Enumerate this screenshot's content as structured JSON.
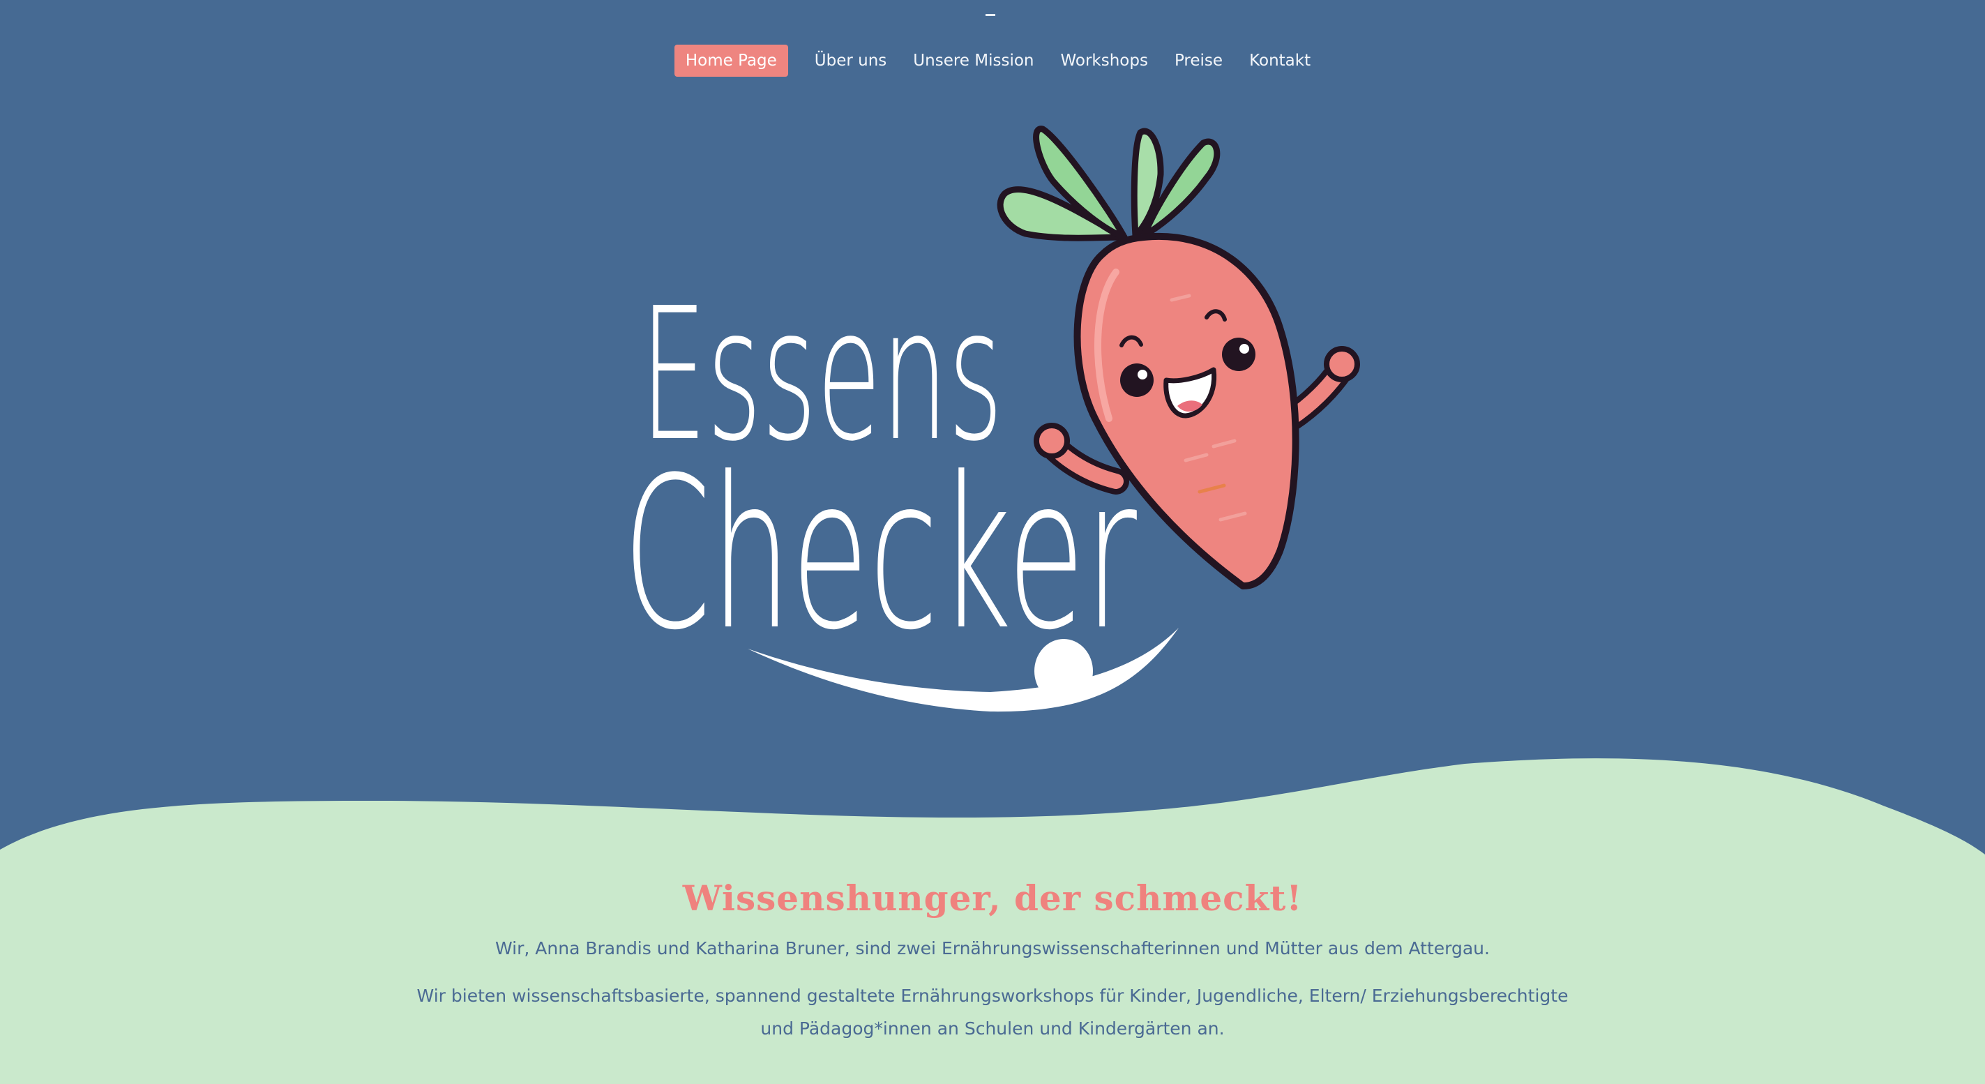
{
  "nav": {
    "items": [
      {
        "label": "Home Page",
        "active": true
      },
      {
        "label": "Über uns",
        "active": false
      },
      {
        "label": "Unsere Mission",
        "active": false
      },
      {
        "label": "Workshops",
        "active": false
      },
      {
        "label": "Preise",
        "active": false
      },
      {
        "label": "Kontakt",
        "active": false
      }
    ]
  },
  "logo": {
    "line1": "Essens",
    "line2": "Checker",
    "mascot": "carrot-mascot"
  },
  "intro": {
    "headline": "Wissenshunger, der schmeckt!",
    "paragraph1": "Wir, Anna Brandis und Katharina Bruner, sind zwei Ernährungswissenschafterinnen und Mütter aus dem Attergau.",
    "paragraph2": "Wir bieten wissenschaftsbasierte, spannend gestaltete Ernährungsworkshops für Kinder, Jugendliche, Eltern/ Erziehungsberechtigte und Pädagog*innen an Schulen und Kindergärten an."
  },
  "colors": {
    "background": "#466a93",
    "wave": "#cae9cc",
    "accent": "#ef827e",
    "text": "#4a6a93"
  }
}
